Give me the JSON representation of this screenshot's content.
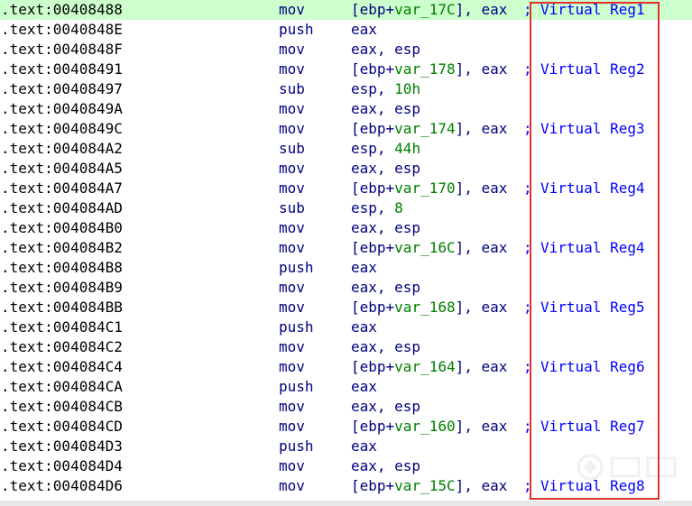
{
  "rows": [
    {
      "addr": ".text:00408488",
      "mnem": "mov",
      "ops": [
        {
          "t": "[ebp+",
          "c": ""
        },
        {
          "t": "var_17C",
          "c": "var"
        },
        {
          "t": "], eax",
          "c": ""
        }
      ],
      "semi": ";",
      "comment": "Virtual Reg1",
      "highlight": true
    },
    {
      "addr": ".text:0040848E",
      "mnem": "push",
      "ops": [
        {
          "t": "eax",
          "c": ""
        }
      ]
    },
    {
      "addr": ".text:0040848F",
      "mnem": "mov",
      "ops": [
        {
          "t": "eax, esp",
          "c": ""
        }
      ]
    },
    {
      "addr": ".text:00408491",
      "mnem": "mov",
      "ops": [
        {
          "t": "[ebp+",
          "c": ""
        },
        {
          "t": "var_178",
          "c": "var"
        },
        {
          "t": "], eax",
          "c": ""
        }
      ],
      "semi": ";",
      "comment": "Virtual Reg2"
    },
    {
      "addr": ".text:00408497",
      "mnem": "sub",
      "ops": [
        {
          "t": "esp, ",
          "c": ""
        },
        {
          "t": "10h",
          "c": "num"
        }
      ]
    },
    {
      "addr": ".text:0040849A",
      "mnem": "mov",
      "ops": [
        {
          "t": "eax, esp",
          "c": ""
        }
      ]
    },
    {
      "addr": ".text:0040849C",
      "mnem": "mov",
      "ops": [
        {
          "t": "[ebp+",
          "c": ""
        },
        {
          "t": "var_174",
          "c": "var"
        },
        {
          "t": "], eax",
          "c": ""
        }
      ],
      "semi": ";",
      "comment": "Virtual Reg3"
    },
    {
      "addr": ".text:004084A2",
      "mnem": "sub",
      "ops": [
        {
          "t": "esp, ",
          "c": ""
        },
        {
          "t": "44h",
          "c": "num"
        }
      ]
    },
    {
      "addr": ".text:004084A5",
      "mnem": "mov",
      "ops": [
        {
          "t": "eax, esp",
          "c": ""
        }
      ]
    },
    {
      "addr": ".text:004084A7",
      "mnem": "mov",
      "ops": [
        {
          "t": "[ebp+",
          "c": ""
        },
        {
          "t": "var_170",
          "c": "var"
        },
        {
          "t": "], eax",
          "c": ""
        }
      ],
      "semi": ";",
      "comment": "Virtual Reg4"
    },
    {
      "addr": ".text:004084AD",
      "mnem": "sub",
      "ops": [
        {
          "t": "esp, ",
          "c": ""
        },
        {
          "t": "8",
          "c": "num"
        }
      ]
    },
    {
      "addr": ".text:004084B0",
      "mnem": "mov",
      "ops": [
        {
          "t": "eax, esp",
          "c": ""
        }
      ]
    },
    {
      "addr": ".text:004084B2",
      "mnem": "mov",
      "ops": [
        {
          "t": "[ebp+",
          "c": ""
        },
        {
          "t": "var_16C",
          "c": "var"
        },
        {
          "t": "], eax",
          "c": ""
        }
      ],
      "semi": ";",
      "comment": "Virtual Reg4"
    },
    {
      "addr": ".text:004084B8",
      "mnem": "push",
      "ops": [
        {
          "t": "eax",
          "c": ""
        }
      ]
    },
    {
      "addr": ".text:004084B9",
      "mnem": "mov",
      "ops": [
        {
          "t": "eax, esp",
          "c": ""
        }
      ]
    },
    {
      "addr": ".text:004084BB",
      "mnem": "mov",
      "ops": [
        {
          "t": "[ebp+",
          "c": ""
        },
        {
          "t": "var_168",
          "c": "var"
        },
        {
          "t": "], eax",
          "c": ""
        }
      ],
      "semi": ";",
      "comment": "Virtual Reg5"
    },
    {
      "addr": ".text:004084C1",
      "mnem": "push",
      "ops": [
        {
          "t": "eax",
          "c": ""
        }
      ]
    },
    {
      "addr": ".text:004084C2",
      "mnem": "mov",
      "ops": [
        {
          "t": "eax, esp",
          "c": ""
        }
      ]
    },
    {
      "addr": ".text:004084C4",
      "mnem": "mov",
      "ops": [
        {
          "t": "[ebp+",
          "c": ""
        },
        {
          "t": "var_164",
          "c": "var"
        },
        {
          "t": "], eax",
          "c": ""
        }
      ],
      "semi": ";",
      "comment": "Virtual Reg6"
    },
    {
      "addr": ".text:004084CA",
      "mnem": "push",
      "ops": [
        {
          "t": "eax",
          "c": ""
        }
      ]
    },
    {
      "addr": ".text:004084CB",
      "mnem": "mov",
      "ops": [
        {
          "t": "eax, esp",
          "c": ""
        }
      ]
    },
    {
      "addr": ".text:004084CD",
      "mnem": "mov",
      "ops": [
        {
          "t": "[ebp+",
          "c": ""
        },
        {
          "t": "var_160",
          "c": "var"
        },
        {
          "t": "], eax",
          "c": ""
        }
      ],
      "semi": ";",
      "comment": "Virtual Reg7"
    },
    {
      "addr": ".text:004084D3",
      "mnem": "push",
      "ops": [
        {
          "t": "eax",
          "c": ""
        }
      ]
    },
    {
      "addr": ".text:004084D4",
      "mnem": "mov",
      "ops": [
        {
          "t": "eax, esp",
          "c": ""
        }
      ]
    },
    {
      "addr": ".text:004084D6",
      "mnem": "mov",
      "ops": [
        {
          "t": "[ebp+",
          "c": ""
        },
        {
          "t": "var_15C",
          "c": "var"
        },
        {
          "t": "], eax",
          "c": ""
        }
      ],
      "semi": ";",
      "comment": "Virtual Reg8"
    }
  ],
  "colors": {
    "highlight_row": "#ccffcc",
    "annotation_box": "#e03030",
    "address": "#000000",
    "instruction": "#000080",
    "variable": "#008000",
    "comment": "#0000ff"
  },
  "icons": {
    "watermark": "kanxue-watermark-icon"
  }
}
